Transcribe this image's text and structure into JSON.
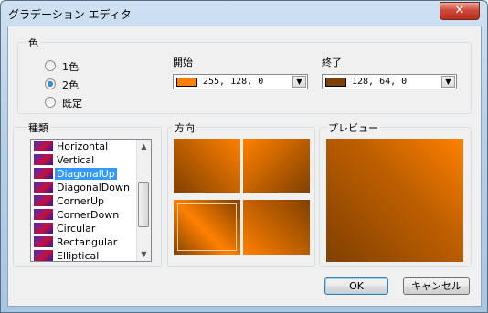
{
  "window": {
    "title": "グラデーション エディタ",
    "close_symbol": "✕"
  },
  "color_group": {
    "label": "色",
    "options": [
      {
        "label": "1色",
        "checked": false
      },
      {
        "label": "2色",
        "checked": true
      },
      {
        "label": "既定",
        "checked": false
      }
    ],
    "start": {
      "label": "開始",
      "value": "255, 128, 0",
      "swatch": "#ff8000"
    },
    "end": {
      "label": "終了",
      "value": "128, 64, 0",
      "swatch": "#804000"
    },
    "dropdown_symbol": "▼"
  },
  "kind_group": {
    "label": "種類",
    "items": [
      "Horizontal",
      "Vertical",
      "DiagonalUp",
      "DiagonalDown",
      "CornerUp",
      "CornerDown",
      "Circular",
      "Rectangular",
      "Elliptical"
    ],
    "selected": "DiagonalUp",
    "scroll_up": "▲",
    "scroll_down": "▼"
  },
  "direction_group": {
    "label": "方向"
  },
  "preview_group": {
    "label": "プレビュー"
  },
  "buttons": {
    "ok": "OK",
    "cancel": "キャンセル"
  },
  "colors": {
    "start": "#ff8000",
    "end": "#804000",
    "selection": "#3399ff"
  }
}
